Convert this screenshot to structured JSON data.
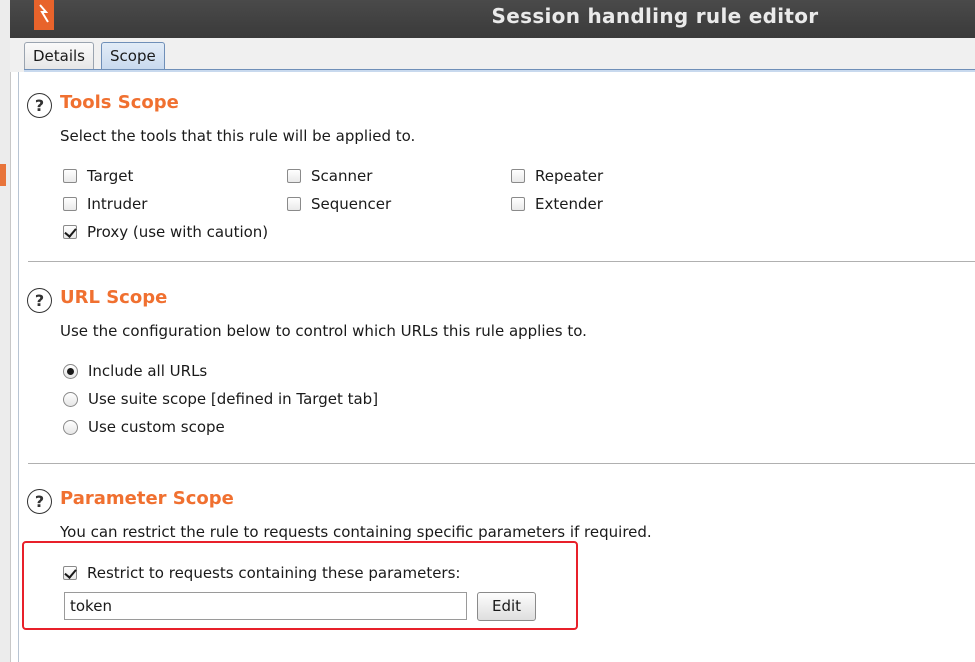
{
  "window": {
    "title": "Session handling rule editor"
  },
  "tabs": [
    {
      "label": "Details"
    },
    {
      "label": "Scope"
    }
  ],
  "tools_scope": {
    "title": "Tools Scope",
    "description": "Select the tools that this rule will be applied to.",
    "options": [
      {
        "label": "Target",
        "checked": false
      },
      {
        "label": "Scanner",
        "checked": false
      },
      {
        "label": "Repeater",
        "checked": false
      },
      {
        "label": "Intruder",
        "checked": false
      },
      {
        "label": "Sequencer",
        "checked": false
      },
      {
        "label": "Extender",
        "checked": false
      },
      {
        "label": "Proxy (use with caution)",
        "checked": true
      }
    ]
  },
  "url_scope": {
    "title": "URL Scope",
    "description": "Use the configuration below to control which URLs this rule applies to.",
    "options": [
      {
        "label": "Include all URLs",
        "selected": true
      },
      {
        "label": "Use suite scope [defined in Target tab]",
        "selected": false
      },
      {
        "label": "Use custom scope",
        "selected": false
      }
    ]
  },
  "parameter_scope": {
    "title": "Parameter Scope",
    "description": "You can restrict the rule to requests containing specific parameters if required.",
    "restrict_label": "Restrict to requests containing these parameters:",
    "restrict_checked": true,
    "parameters_value": "token",
    "edit_label": "Edit"
  },
  "help_glyph": "?",
  "colors": {
    "section_title": "#f07030",
    "highlight": "#e8202a",
    "titlebar": "#3f3f3f"
  }
}
